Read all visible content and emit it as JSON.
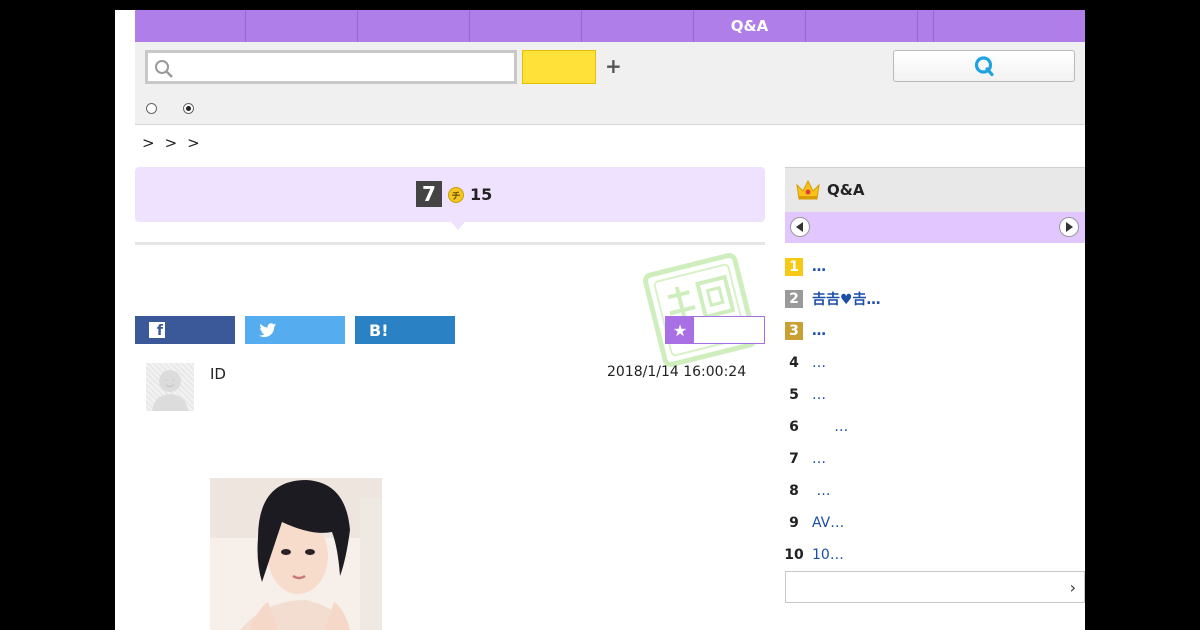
{
  "nav": {
    "items": [
      "",
      "",
      "",
      "",
      "",
      "Q&A",
      "",
      "",
      ""
    ]
  },
  "search": {
    "placeholder": "",
    "button_label": "",
    "ask_button_icon": "Q",
    "radio_options": [
      "",
      ""
    ],
    "selected_radio": 1
  },
  "breadcrumb": [
    ">",
    ">",
    ">"
  ],
  "question": {
    "answer_count": "7",
    "coin_label": "チ",
    "coins": "15"
  },
  "share": {
    "facebook_icon": "f",
    "twitter_icon": "twitter-bird-icon",
    "hatena_label": "B!",
    "favorite_label": ""
  },
  "post": {
    "user_id": "ID",
    "timestamp": "2018/1/14  16:00:24"
  },
  "ranking": {
    "title": "Q&A",
    "items": [
      {
        "rank": "1",
        "text": "…",
        "style": "gold"
      },
      {
        "rank": "2",
        "text": "𠮷𠮷♥𠮷…",
        "style": "silver"
      },
      {
        "rank": "3",
        "text": "…",
        "style": "bronze"
      },
      {
        "rank": "4",
        "text": "…",
        "style": ""
      },
      {
        "rank": "5",
        "text": "…",
        "style": ""
      },
      {
        "rank": "6",
        "text": "     …",
        "style": ""
      },
      {
        "rank": "7",
        "text": "…",
        "style": ""
      },
      {
        "rank": "8",
        "text": " …",
        "style": ""
      },
      {
        "rank": "9",
        "text": "AV…",
        "style": ""
      },
      {
        "rank": "10",
        "text": "10…",
        "style": ""
      }
    ],
    "more_label": "›"
  },
  "colors": {
    "nav": "#b07ee8",
    "question_bg": "#efe2ff",
    "rank_tabs": "#e1c6ff",
    "search_button": "#ffe13a",
    "link": "#1b4ea8"
  }
}
